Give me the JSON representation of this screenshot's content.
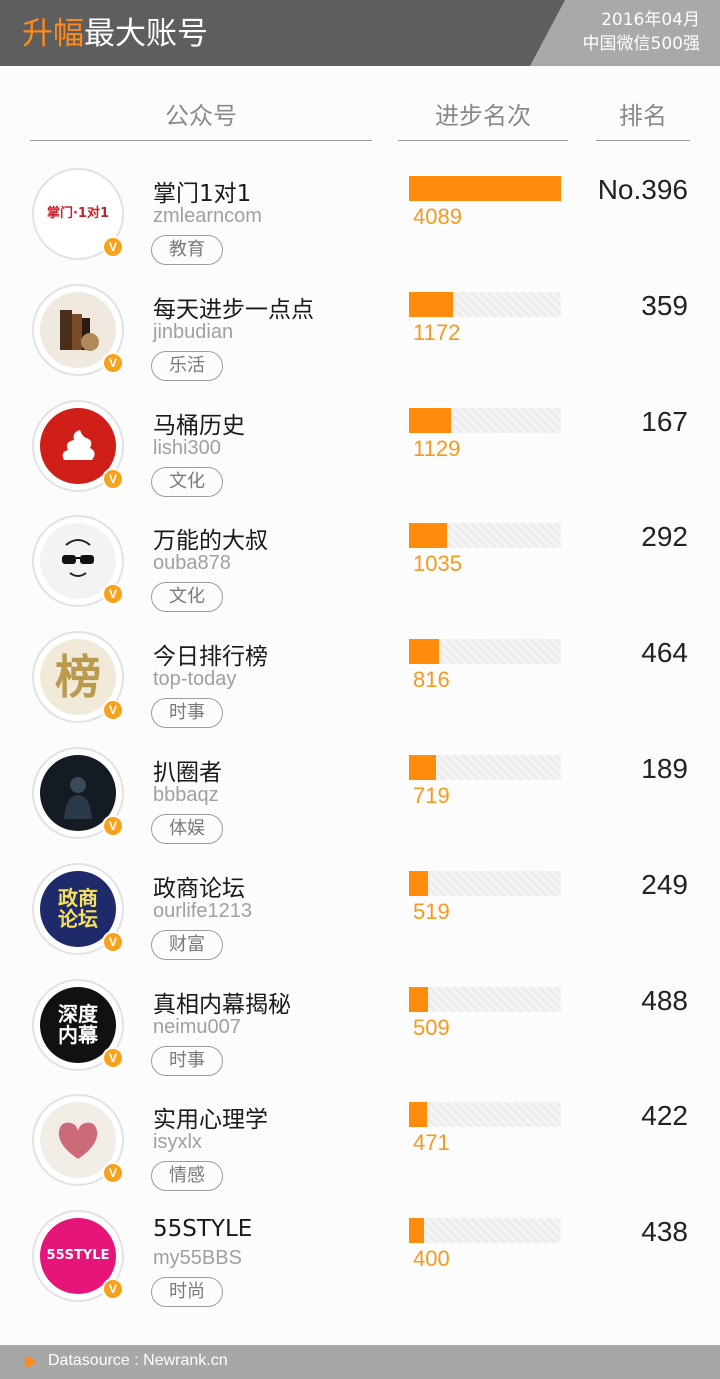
{
  "header": {
    "title_accent": "升幅",
    "title_main": "最大账号",
    "date": "2016年04月",
    "subtitle": "中国微信500强"
  },
  "columns": {
    "account": "公众号",
    "progress": "进步名次",
    "rank": "排名"
  },
  "rows": [
    {
      "name": "掌门1对1",
      "handle": "zmlearncom",
      "tag": "教育",
      "progress": 4089,
      "rank": "No.396",
      "avatar_icon": "zmlearn-logo",
      "avatar_text": "掌门·1对1"
    },
    {
      "name": "每天进步一点点",
      "handle": "jinbudian",
      "tag": "乐活",
      "progress": 1172,
      "rank": "359",
      "avatar_icon": "books-logo",
      "avatar_text": ""
    },
    {
      "name": "马桶历史",
      "handle": "lishi300",
      "tag": "文化",
      "progress": 1129,
      "rank": "167",
      "avatar_icon": "poop-logo",
      "avatar_text": ""
    },
    {
      "name": "万能的大叔",
      "handle": "ouba878",
      "tag": "文化",
      "progress": 1035,
      "rank": "292",
      "avatar_icon": "uncle-sunglasses-logo",
      "avatar_text": ""
    },
    {
      "name": "今日排行榜",
      "handle": "top-today",
      "tag": "时事",
      "progress": 816,
      "rank": "464",
      "avatar_icon": "bang-logo",
      "avatar_text": "榜"
    },
    {
      "name": "扒圈者",
      "handle": "bbbaqz",
      "tag": "体娱",
      "progress": 719,
      "rank": "189",
      "avatar_icon": "silhouette-logo",
      "avatar_text": ""
    },
    {
      "name": "政商论坛",
      "handle": "ourlife1213",
      "tag": "财富",
      "progress": 519,
      "rank": "249",
      "avatar_icon": "zhengshang-logo",
      "avatar_text": "政商论坛"
    },
    {
      "name": "真相内幕揭秘",
      "handle": "neimu007",
      "tag": "时事",
      "progress": 509,
      "rank": "488",
      "avatar_icon": "shendu-logo",
      "avatar_text": "深度内幕"
    },
    {
      "name": "实用心理学",
      "handle": "isyxlx",
      "tag": "情感",
      "progress": 471,
      "rank": "422",
      "avatar_icon": "fingerprint-heart-logo",
      "avatar_text": ""
    },
    {
      "name": "55STYLE",
      "handle": "my55BBS",
      "tag": "时尚",
      "progress": 400,
      "rank": "438",
      "avatar_icon": "55style-logo",
      "avatar_text": "55STYLE"
    }
  ],
  "progress_max": 4089,
  "footer": {
    "datasource": "Datasource : Newrank.cn"
  },
  "colors": {
    "accent": "#ff8a1c",
    "bar": "#ff8c0a",
    "header_bg": "#5f5e5e",
    "badge": "#f6a21c"
  }
}
